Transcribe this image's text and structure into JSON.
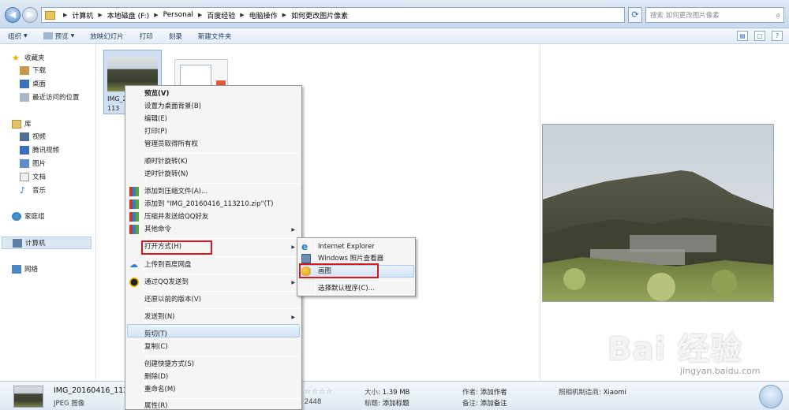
{
  "address": {
    "crumbs": [
      "计算机",
      "本地磁盘 (F:)",
      "Personal",
      "百度经验",
      "电脑操作",
      "如何更改图片像素"
    ],
    "search_placeholder": "搜索 如何更改图片像素"
  },
  "toolbar": {
    "organize": "组织",
    "preview": "预览",
    "slideshow": "放映幻灯片",
    "print": "打印",
    "burn": "刻录",
    "new_folder": "新建文件夹"
  },
  "sidebar": {
    "favorites": "收藏夹",
    "downloads": "下载",
    "desktop": "桌面",
    "recent": "最近访问的位置",
    "library": "库",
    "videos": "视频",
    "tencent_video": "腾讯视频",
    "pictures": "图片",
    "documents": "文档",
    "music": "音乐",
    "homegroup": "家庭组",
    "computer": "计算机",
    "network": "网络"
  },
  "file": {
    "name_line1": "IMG_2",
    "name_line2": "113"
  },
  "context_menu": {
    "items": [
      {
        "label": "预览(V)",
        "bold": true
      },
      {
        "label": "设置为桌面背景(B)"
      },
      {
        "label": "编辑(E)"
      },
      {
        "label": "打印(P)"
      },
      {
        "label": "管理员取得所有权"
      },
      {
        "label": "顺时针旋转(K)"
      },
      {
        "label": "逆时针旋转(N)"
      },
      {
        "label": "添加到压缩文件(A)..."
      },
      {
        "label": "添加到 \"IMG_20160416_113210.zip\"(T)"
      },
      {
        "label": "压缩并发送给QQ好友"
      },
      {
        "label": "其他命令"
      },
      {
        "label": "打开方式(H)"
      },
      {
        "label": "上传到百度网盘"
      },
      {
        "label": "通过QQ发送到"
      },
      {
        "label": "还原以前的版本(V)"
      },
      {
        "label": "发送到(N)"
      },
      {
        "label": "剪切(T)"
      },
      {
        "label": "复制(C)"
      },
      {
        "label": "创建快捷方式(S)"
      },
      {
        "label": "删除(D)"
      },
      {
        "label": "重命名(M)"
      },
      {
        "label": "属性(R)"
      }
    ]
  },
  "open_with": {
    "items": [
      "Internet Explorer",
      "Windows 照片查看器",
      "画图",
      "选择默认程序(C)..."
    ]
  },
  "details": {
    "filename": "IMG_20160416_113",
    "type": "JPEG 图像",
    "dims": "x 2448",
    "size_label": "大小:",
    "size_value": "1.39 MB",
    "title_label": "标题:",
    "title_value": "添加标题",
    "author_label": "作者:",
    "author_value": "添加作者",
    "remark_label": "备注:",
    "remark_value": "添加备注",
    "maker_label": "照相机制造商:",
    "maker_value": "Xiaomi"
  },
  "watermark": {
    "brand": "Bai 经验",
    "url": "jingyan.baidu.com"
  },
  "colors": {
    "accent_red": "#d8161e",
    "highlight": "#d4e5f8"
  }
}
